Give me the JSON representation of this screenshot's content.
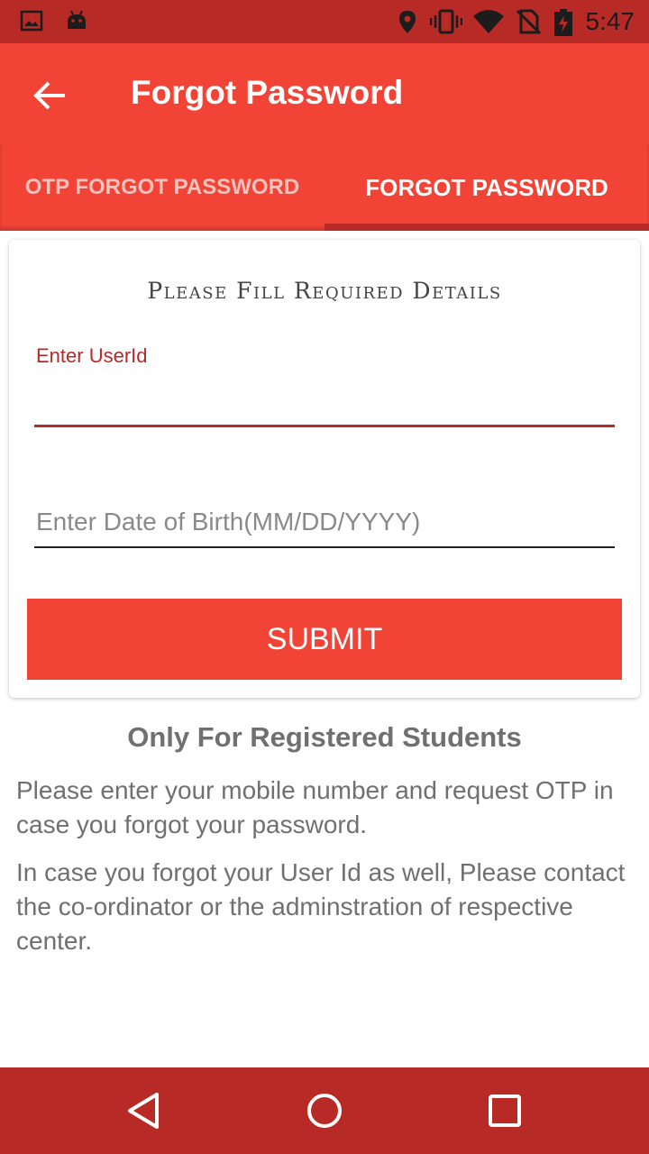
{
  "status_bar": {
    "time": "5:47",
    "icons": [
      "image-icon",
      "android-icon",
      "location-icon",
      "vibrate-icon",
      "wifi-icon",
      "no-sim-icon",
      "battery-charging-icon"
    ]
  },
  "app_bar": {
    "title": "Forgot Password",
    "back_icon": "arrow-back-icon"
  },
  "tabs": [
    {
      "label": "OTP FORGOT PASSWORD",
      "selected": false
    },
    {
      "label": "FORGOT PASSWORD",
      "selected": true
    }
  ],
  "form": {
    "heading": "Please Fill Required Details",
    "userid_label": "Enter UserId",
    "userid_value": "",
    "dob_placeholder": "Enter Date of Birth(MM/DD/YYYY)",
    "submit_label": "SUBMIT"
  },
  "info": {
    "title": "Only For Registered Students",
    "paragraph1": "Please enter your mobile number and request OTP in case you forgot your password.",
    "paragraph2": "In case you forgot your User Id as well, Please contact the co-ordinator or the adminstration of respective center."
  },
  "colors": {
    "primary": "#f24436",
    "primary_dark": "#b72a26",
    "text_muted": "#707070"
  }
}
